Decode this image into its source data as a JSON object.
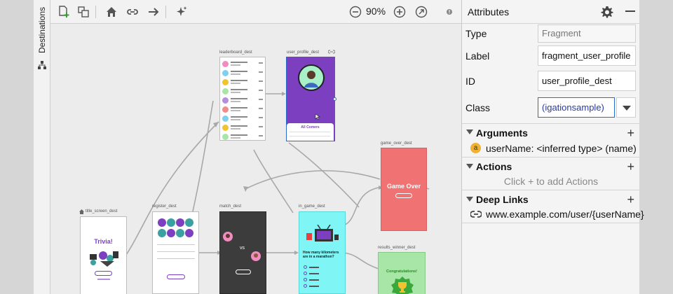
{
  "sidebar": {
    "label": "Destinations"
  },
  "toolbar": {
    "zoom": "90%"
  },
  "canvas": {
    "destinations": {
      "leaderboard": "leaderboard_dest",
      "user_profile": "user_profile_dest",
      "game_over": "game_over_dest",
      "title_screen": "title_screen_dest",
      "register": "register_dest",
      "match": "match_dest",
      "in_game": "in_game_dest",
      "results_winner": "results_winner_dest"
    },
    "screens": {
      "title_trivia": "Trivia!",
      "profile_button": "All Comers",
      "game_over_text": "Game Over",
      "match_vs": "vs",
      "question": "How many kilometers are in a marathon?",
      "congrats": "Congratulations!"
    }
  },
  "attributes": {
    "title": "Attributes",
    "type_label": "Type",
    "type_value": "Fragment",
    "label_label": "Label",
    "label_value": "fragment_user_profile",
    "id_label": "ID",
    "id_value": "user_profile_dest",
    "class_label": "Class",
    "class_value": "(igationsample)",
    "arguments_title": "Arguments",
    "argument_badge": "a",
    "argument_text": "userName: <inferred type> (name)",
    "actions_title": "Actions",
    "actions_hint": "Click + to add Actions",
    "deeplinks_title": "Deep Links",
    "deeplink_text": "www.example.com/user/{userName}"
  },
  "colors": {
    "accent": "#2a6ac8",
    "profile_purple": "#7b3fbf",
    "game_over_red": "#f07272",
    "in_game_cyan": "#7ff5f5",
    "winner_green": "#a8e6a8",
    "match_dark": "#3c3c3c"
  }
}
